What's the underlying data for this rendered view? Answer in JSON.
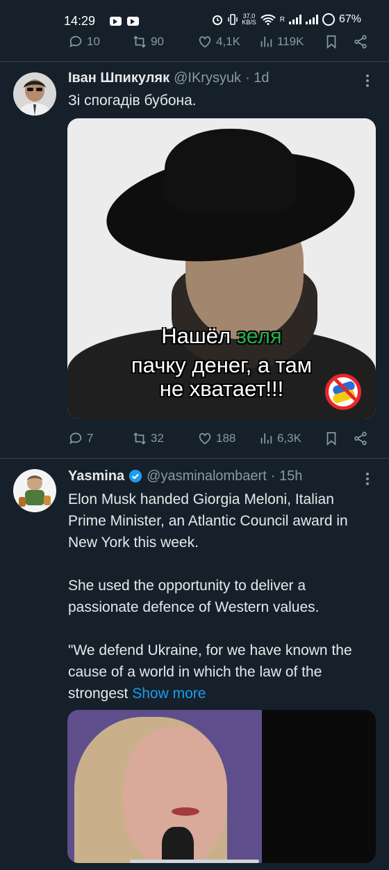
{
  "status_bar": {
    "time": "14:29",
    "net_speed_value": "37,0",
    "net_speed_unit": "KB/S",
    "wifi_label": "R",
    "battery": "67%"
  },
  "top_actions": {
    "replies": "10",
    "reposts": "90",
    "likes": "4,1K",
    "views": "119K"
  },
  "tweets": [
    {
      "author": "Іван Шпикуляк",
      "handle": "@IKrysyuk",
      "time": "· 1d",
      "text": "Зі спогадів бубона.",
      "media": {
        "caption_line1_white": "Нашёл ",
        "caption_line1_green": "зеля",
        "caption_line2": "пачку денег, а там",
        "caption_line3": "не хватает!!!"
      },
      "actions": {
        "replies": "7",
        "reposts": "32",
        "likes": "188",
        "views": "6,3K"
      }
    },
    {
      "author": "Yasmina",
      "handle": "@yasminalombaert",
      "time": "· 15h",
      "verified": true,
      "paragraphs": [
        "Elon Musk handed Giorgia Meloni, Italian Prime Minister, an Atlantic Council award in New York this week.",
        "She used the opportunity to deliver a passionate defence of Western values.",
        "\"We defend Ukraine, for we have known the cause of a world in which the law of the strongest"
      ],
      "show_more": "Show more"
    }
  ],
  "colors": {
    "background": "#15202b",
    "accent": "#1d9bf0",
    "muted": "#8b98a5",
    "divider": "#38444d"
  }
}
